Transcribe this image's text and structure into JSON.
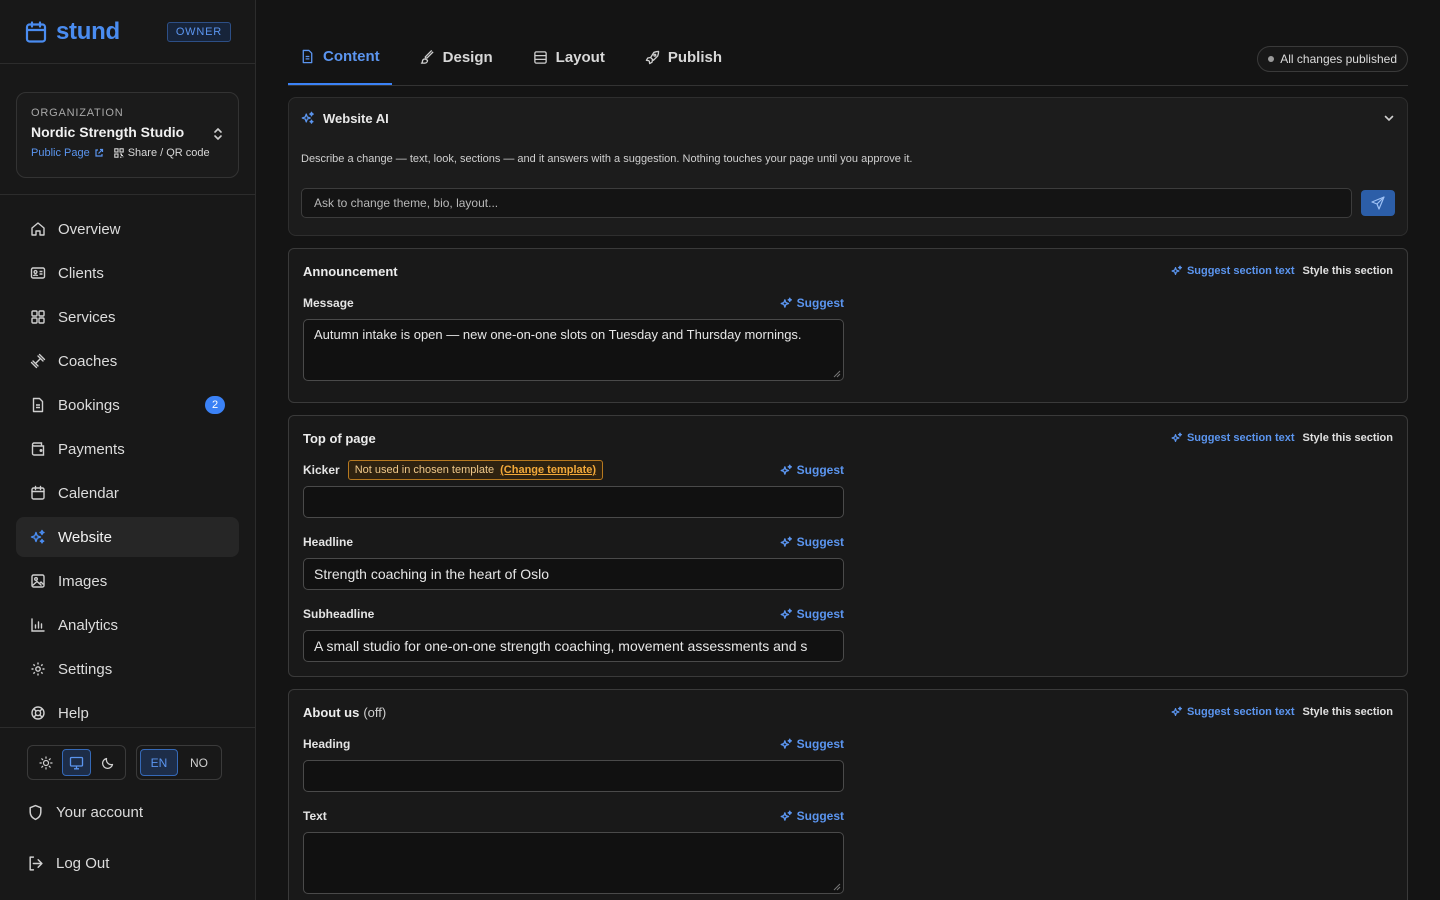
{
  "brand": {
    "name": "stund",
    "role": "OWNER",
    "accent": "#4a8cf0"
  },
  "org": {
    "label": "ORGANIZATION",
    "name": "Nordic Strength Studio",
    "public_page": "Public Page",
    "share": "Share / QR code"
  },
  "nav": [
    {
      "label": "Overview",
      "icon": "home-icon"
    },
    {
      "label": "Clients",
      "icon": "id-card-icon"
    },
    {
      "label": "Services",
      "icon": "grid-icon"
    },
    {
      "label": "Coaches",
      "icon": "dumbbell-icon"
    },
    {
      "label": "Bookings",
      "icon": "document-icon",
      "badge": "2"
    },
    {
      "label": "Payments",
      "icon": "wallet-icon"
    },
    {
      "label": "Calendar",
      "icon": "calendar-icon"
    },
    {
      "label": "Website",
      "icon": "sparkles-icon",
      "active": true
    },
    {
      "label": "Images",
      "icon": "image-icon"
    },
    {
      "label": "Analytics",
      "icon": "bar-chart-icon"
    },
    {
      "label": "Settings",
      "icon": "gear-icon"
    },
    {
      "label": "Help",
      "icon": "lifebuoy-icon"
    }
  ],
  "toggles": {
    "lang_en": "EN",
    "lang_no": "NO",
    "theme_selected": "system"
  },
  "account": {
    "your_account": "Your account",
    "logout": "Log Out"
  },
  "tabs": [
    {
      "label": "Content",
      "icon": "document-icon",
      "active": true
    },
    {
      "label": "Design",
      "icon": "brush-icon"
    },
    {
      "label": "Layout",
      "icon": "layout-icon"
    },
    {
      "label": "Publish",
      "icon": "rocket-icon"
    }
  ],
  "status": "All changes published",
  "ai": {
    "title": "Website AI",
    "description": "Describe a change — text, look, sections — and it answers with a suggestion. Nothing touches your page until you approve it.",
    "placeholder": "Ask to change theme, bio, layout..."
  },
  "labels": {
    "suggest": "Suggest",
    "suggest_section": "Suggest section text",
    "style_section": "Style this section"
  },
  "sections": {
    "announcement": {
      "title": "Announcement",
      "message_label": "Message",
      "message_value": "Autumn intake is open — new one-on-one slots on Tuesday and Thursday mornings."
    },
    "top": {
      "title": "Top of page",
      "kicker_label": "Kicker",
      "kicker_warning": "Not used in chosen template",
      "kicker_change": "(Change template)",
      "kicker_value": "",
      "headline_label": "Headline",
      "headline_value": "Strength coaching in the heart of Oslo",
      "subheadline_label": "Subheadline",
      "subheadline_value": "A small studio for one-on-one strength coaching, movement assessments and s"
    },
    "about": {
      "title": "About us",
      "state": "(off)",
      "heading_label": "Heading",
      "heading_value": "",
      "text_label": "Text",
      "text_value": ""
    }
  }
}
